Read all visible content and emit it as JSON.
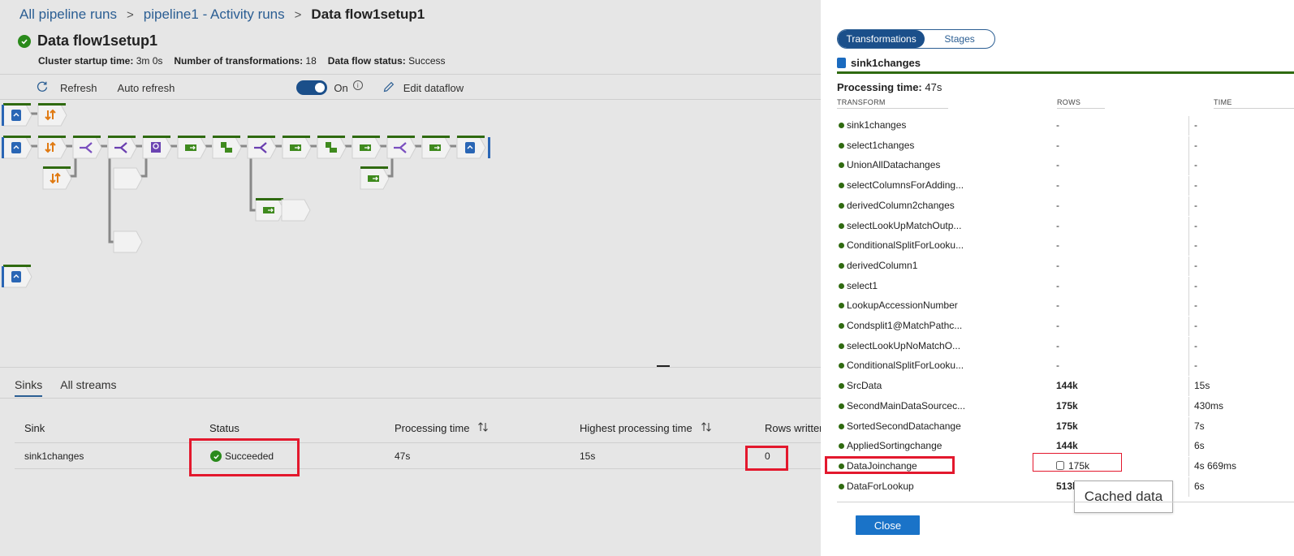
{
  "breadcrumb": [
    "All pipeline runs",
    "pipeline1 - Activity runs",
    "Data flow1setup1"
  ],
  "breadcrumb_sep": ">",
  "page_title": "Data flow1setup1",
  "meta": {
    "cluster_label": "Cluster startup time:",
    "cluster_value": "3m 0s",
    "transforms_label": "Number of transformations:",
    "transforms_value": "18",
    "status_label": "Data flow status:",
    "status_value": "Success"
  },
  "toolbar": {
    "refresh": "Refresh",
    "auto_refresh": "Auto refresh",
    "toggle_state": "On",
    "edit": "Edit dataflow"
  },
  "tabs": [
    "Sinks",
    "All streams"
  ],
  "sinks_table": {
    "headers": [
      "Sink",
      "Status",
      "Processing time",
      "Highest processing time",
      "Rows written"
    ],
    "rows": [
      {
        "sink": "sink1changes",
        "status": "Succeeded",
        "processing_time": "47s",
        "highest_time": "15s",
        "rows_written": "0"
      }
    ]
  },
  "panel": {
    "segments": [
      "Transformations",
      "Stages"
    ],
    "sink_name": "sink1changes",
    "processing_label": "Processing time:",
    "processing_value": "47s",
    "columns": [
      "TRANSFORM",
      "ROWS",
      "TIME"
    ],
    "rows": [
      {
        "name": "sink1changes",
        "rows": "-",
        "time": "-"
      },
      {
        "name": "select1changes",
        "rows": "-",
        "time": "-"
      },
      {
        "name": "UnionAllDatachanges",
        "rows": "-",
        "time": "-"
      },
      {
        "name": "selectColumnsForAdding...",
        "rows": "-",
        "time": "-"
      },
      {
        "name": "derivedColumn2changes",
        "rows": "-",
        "time": "-"
      },
      {
        "name": "selectLookUpMatchOutp...",
        "rows": "-",
        "time": "-"
      },
      {
        "name": "ConditionalSplitForLooku...",
        "rows": "-",
        "time": "-"
      },
      {
        "name": "derivedColumn1",
        "rows": "-",
        "time": "-"
      },
      {
        "name": "select1",
        "rows": "-",
        "time": "-"
      },
      {
        "name": "LookupAccessionNumber",
        "rows": "-",
        "time": "-"
      },
      {
        "name": "Condsplit1@MatchPathc...",
        "rows": "-",
        "time": "-"
      },
      {
        "name": "selectLookUpNoMatchO...",
        "rows": "-",
        "time": "-"
      },
      {
        "name": "ConditionalSplitForLooku...",
        "rows": "-",
        "time": "-"
      },
      {
        "name": "SrcData",
        "rows": "144k",
        "time": "15s"
      },
      {
        "name": "SecondMainDataSourcec...",
        "rows": "175k",
        "time": "430ms"
      },
      {
        "name": "SortedSecondDatachange",
        "rows": "175k",
        "time": "7s"
      },
      {
        "name": "AppliedSortingchange",
        "rows": "144k",
        "time": "6s"
      },
      {
        "name": "DataJoinchange",
        "rows": "175k",
        "time": "4s 669ms",
        "cached": true
      },
      {
        "name": "DataForLookup",
        "rows": "513k",
        "time": "6s"
      }
    ],
    "tooltip": "Cached data",
    "close": "Close"
  },
  "colors": {
    "accent": "#1b4f8a",
    "success": "#2a8a1b",
    "highlight": "#e3182d",
    "stream_green": "#2f6a10"
  },
  "flow_nodes": [
    {
      "kind": "source"
    },
    {
      "kind": "sort"
    },
    {
      "kind": "source"
    },
    {
      "kind": "sort"
    },
    {
      "kind": "join"
    },
    {
      "kind": "split"
    },
    {
      "kind": "lookup"
    },
    {
      "kind": "select"
    },
    {
      "kind": "derive"
    },
    {
      "kind": "split"
    },
    {
      "kind": "select"
    },
    {
      "kind": "derive"
    },
    {
      "kind": "select"
    },
    {
      "kind": "join"
    },
    {
      "kind": "select"
    },
    {
      "kind": "sink"
    },
    {
      "kind": "sort"
    },
    {
      "kind": "blank"
    },
    {
      "kind": "select"
    },
    {
      "kind": "blank"
    },
    {
      "kind": "select"
    },
    {
      "kind": "blank"
    },
    {
      "kind": "source"
    }
  ]
}
